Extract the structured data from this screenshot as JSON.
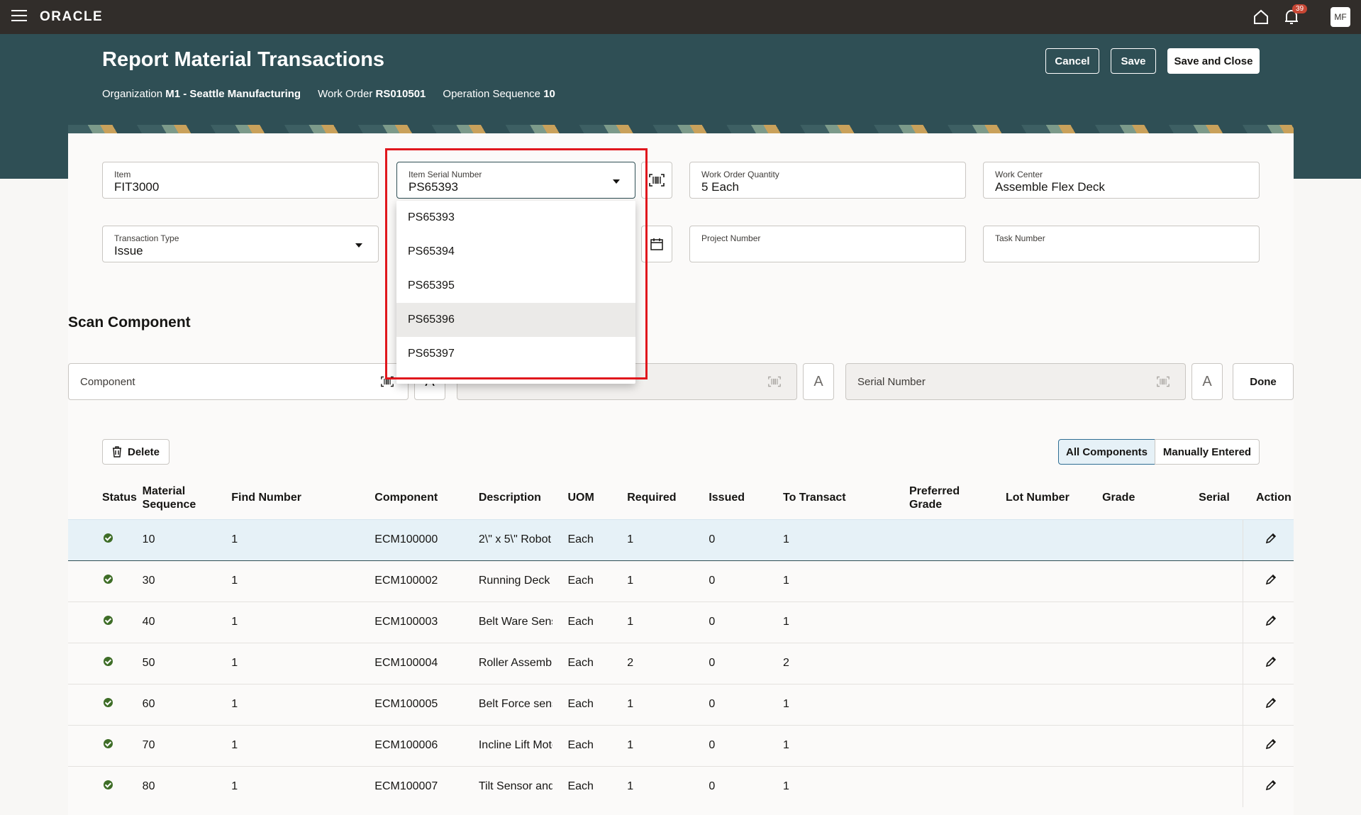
{
  "topbar": {
    "logo": "ORACLE",
    "notification_count": "39",
    "avatar": "MF"
  },
  "header": {
    "title": "Report Material Transactions",
    "org_label": "Organization",
    "org_value": "M1 - Seattle Manufacturing",
    "wo_label": "Work Order",
    "wo_value": "RS010501",
    "op_label": "Operation Sequence",
    "op_value": "10",
    "cancel": "Cancel",
    "save": "Save",
    "save_close": "Save and Close"
  },
  "form": {
    "item": {
      "label": "Item",
      "value": "FIT3000"
    },
    "serial": {
      "label": "Item Serial Number",
      "value": "PS65393"
    },
    "wo_qty": {
      "label": "Work Order Quantity",
      "value": "5 Each"
    },
    "work_center": {
      "label": "Work Center",
      "value": "Assemble Flex Deck"
    },
    "txn_type": {
      "label": "Transaction Type",
      "value": "Issue"
    },
    "project": {
      "label": "Project Number",
      "value": ""
    },
    "task": {
      "label": "Task Number",
      "value": ""
    }
  },
  "serial_options": [
    "PS65393",
    "PS65394",
    "PS65395",
    "PS65396",
    "PS65397"
  ],
  "scan": {
    "title": "Scan Component",
    "component_ph": "Component",
    "serial_ph": "Serial Number",
    "done": "Done"
  },
  "toolbar": {
    "delete": "Delete",
    "all": "All Components",
    "manual": "Manually Entered"
  },
  "table": {
    "headers": {
      "status": "Status",
      "matseq": "Material Sequence",
      "find": "Find Number",
      "component": "Component",
      "desc": "Description",
      "uom": "UOM",
      "required": "Required",
      "issued": "Issued",
      "to_transact": "To Transact",
      "pref_grade": "Preferred Grade",
      "lot": "Lot Number",
      "grade": "Grade",
      "serial": "Serial",
      "action": "Action"
    },
    "rows": [
      {
        "seq": "10",
        "find": "1",
        "comp": "ECM100000",
        "desc": "2\\\" x 5\\\" Robot",
        "uom": "Each",
        "req": "1",
        "iss": "0",
        "tt": "1"
      },
      {
        "seq": "30",
        "find": "1",
        "comp": "ECM100002",
        "desc": "Running Deck",
        "uom": "Each",
        "req": "1",
        "iss": "0",
        "tt": "1"
      },
      {
        "seq": "40",
        "find": "1",
        "comp": "ECM100003",
        "desc": "Belt Ware Sensor",
        "uom": "Each",
        "req": "1",
        "iss": "0",
        "tt": "1"
      },
      {
        "seq": "50",
        "find": "1",
        "comp": "ECM100004",
        "desc": "Roller Assembly",
        "uom": "Each",
        "req": "2",
        "iss": "0",
        "tt": "2"
      },
      {
        "seq": "60",
        "find": "1",
        "comp": "ECM100005",
        "desc": "Belt Force sensor",
        "uom": "Each",
        "req": "1",
        "iss": "0",
        "tt": "1"
      },
      {
        "seq": "70",
        "find": "1",
        "comp": "ECM100006",
        "desc": "Incline Lift Motor",
        "uom": "Each",
        "req": "1",
        "iss": "0",
        "tt": "1"
      },
      {
        "seq": "80",
        "find": "1",
        "comp": "ECM100007",
        "desc": "Tilt Sensor and",
        "uom": "Each",
        "req": "1",
        "iss": "0",
        "tt": "1"
      }
    ]
  }
}
